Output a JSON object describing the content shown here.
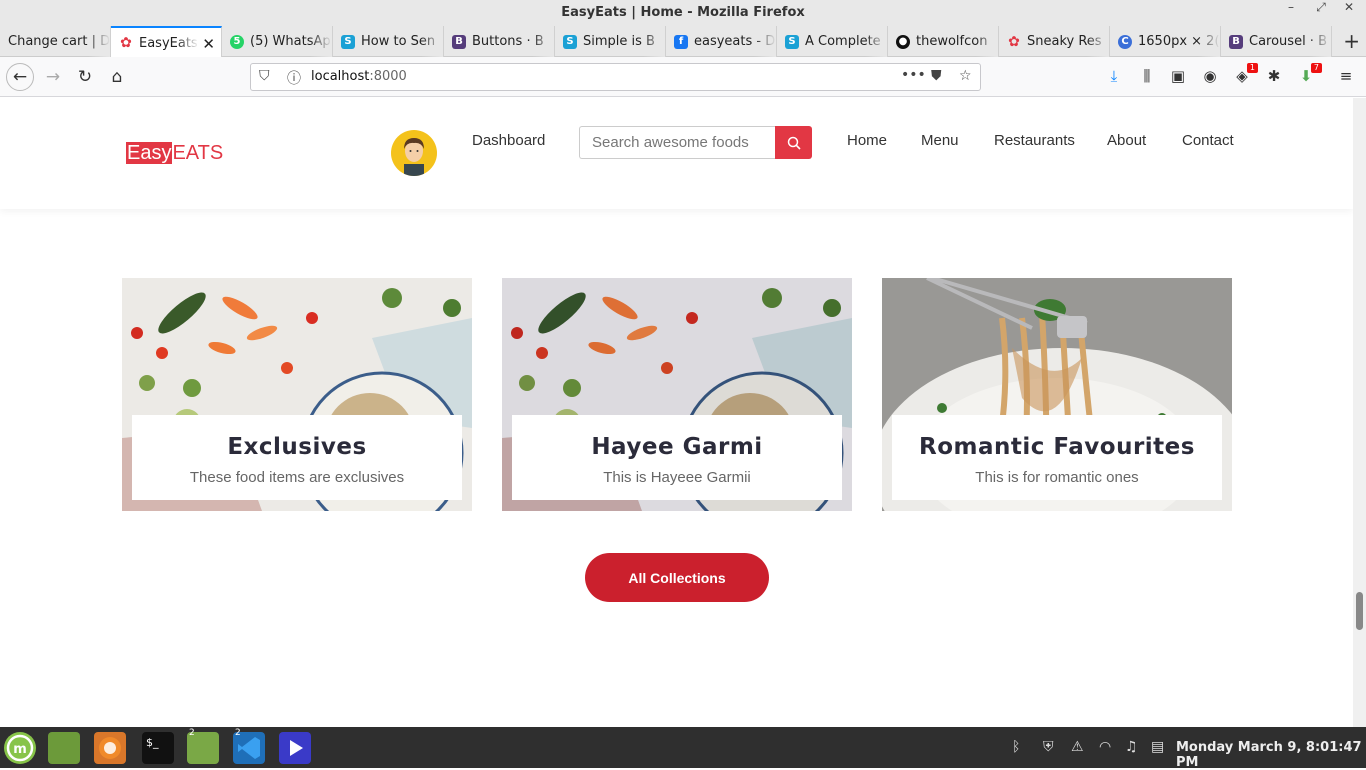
{
  "window": {
    "title": "EasyEats | Home - Mozilla Firefox"
  },
  "tabs": [
    {
      "label": "Change cart | D"
    },
    {
      "label": "EasyEats"
    },
    {
      "label": "(5) WhatsAp"
    },
    {
      "label": "How to Sen"
    },
    {
      "label": "Buttons · B"
    },
    {
      "label": "Simple is B"
    },
    {
      "label": "easyeats - D"
    },
    {
      "label": "A Complete"
    },
    {
      "label": "thewolfcon"
    },
    {
      "label": "Sneaky Res"
    },
    {
      "label": "1650px × 2("
    },
    {
      "label": "Carousel · B"
    }
  ],
  "address": {
    "host": "localhost",
    "port": ":8000"
  },
  "toolbar_badges": {
    "notifications": "1",
    "extension": "7"
  },
  "site": {
    "logo_easy": "Easy",
    "logo_eats": "EATS",
    "dashboard": "Dashboard",
    "search_placeholder": "Search awesome foods",
    "nav": [
      "Home",
      "Menu",
      "Restaurants",
      "About",
      "Contact"
    ]
  },
  "collections": [
    {
      "title": "Exclusives",
      "subtitle": "These food items are exclusives"
    },
    {
      "title": "Hayee Garmi",
      "subtitle": "This is Hayeee Garmii"
    },
    {
      "title": "Romantic Favourites",
      "subtitle": "This is for romantic ones"
    }
  ],
  "all_collections_label": "All Collections",
  "taskbar": {
    "clock": "Monday March 9, 8:01:47 PM",
    "badge_files": "2",
    "badge_code": "2"
  },
  "colors": {
    "brand": "#e23744",
    "button": "#cb202d"
  }
}
